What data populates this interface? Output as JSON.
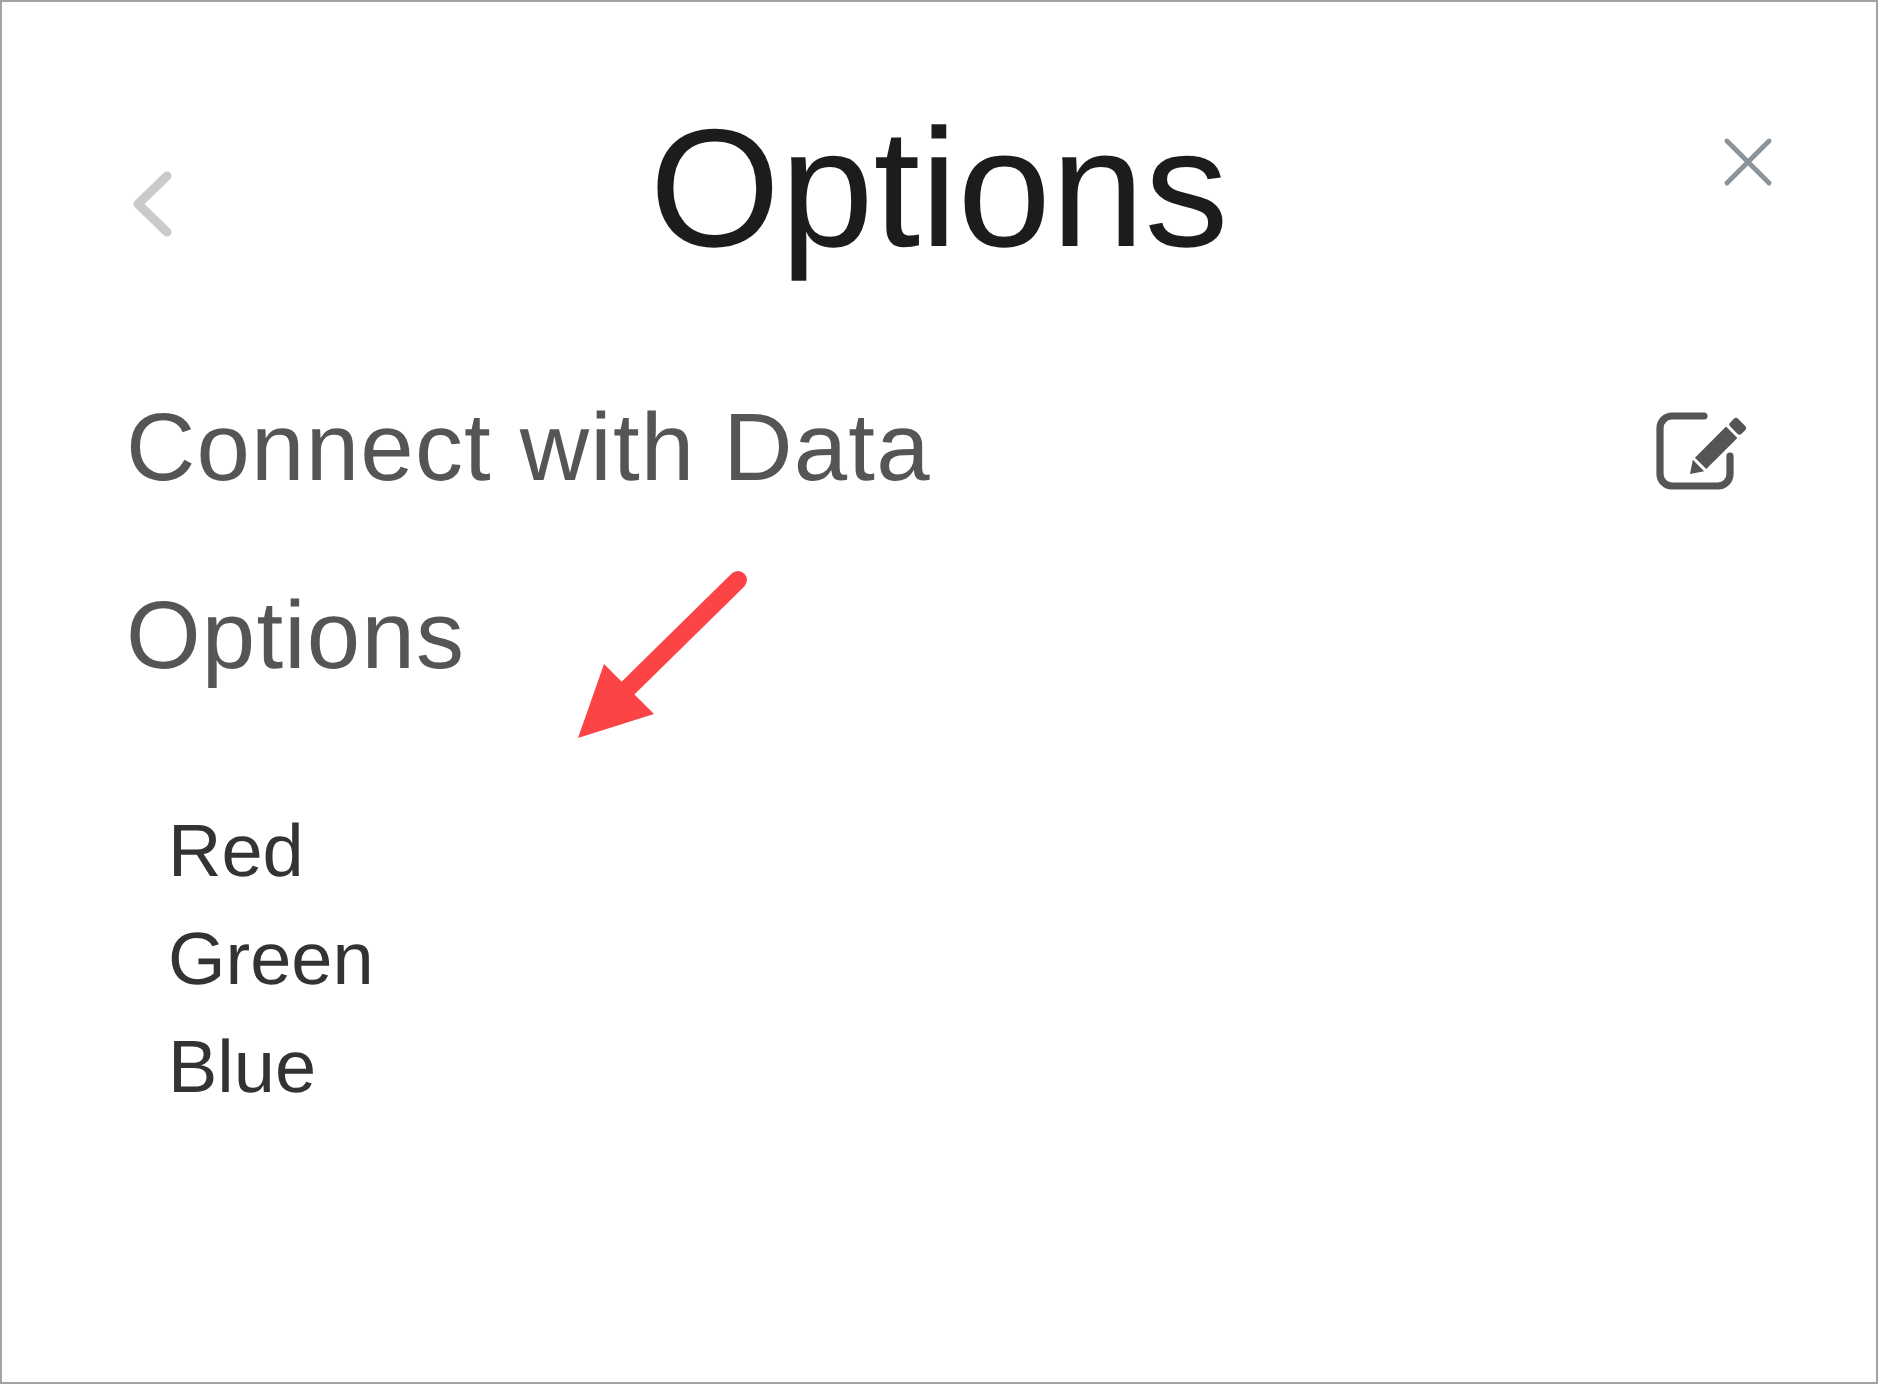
{
  "header": {
    "title": "Options"
  },
  "data_connection": {
    "label": "Connect with Data"
  },
  "options": {
    "heading": "Options",
    "items": [
      {
        "label": "Red"
      },
      {
        "label": "Green"
      },
      {
        "label": "Blue"
      }
    ]
  }
}
